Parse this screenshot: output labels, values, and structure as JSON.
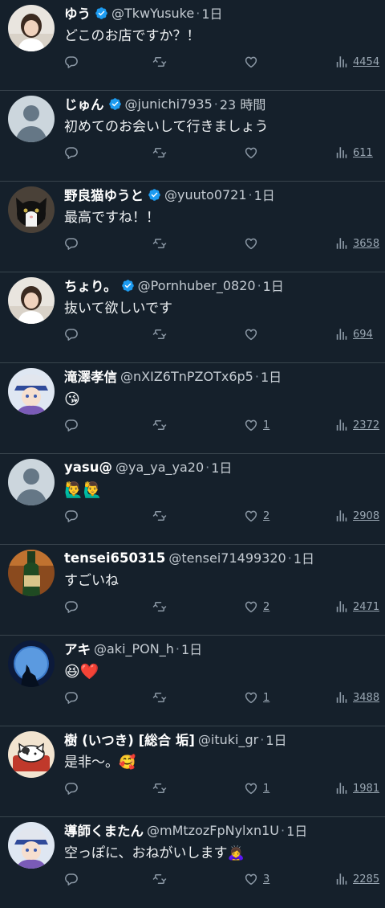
{
  "colors": {
    "background": "#15202b",
    "divider": "#38444d",
    "verified": "#1d9bf0",
    "icon": "#8b98a5"
  },
  "tweets": [
    {
      "name": "ゆう",
      "verified": true,
      "handle": "@TkwYusuke",
      "sep": "·",
      "time": "1日",
      "text": "どこのお店ですか？！",
      "likes": "",
      "views": "4454",
      "avatar": "photo-person"
    },
    {
      "name": "じゅん",
      "verified": true,
      "handle": "@junichi7935",
      "sep": "·",
      "time": "23 時間",
      "text": "初めてのお会いして行きましょう",
      "likes": "",
      "views": "611",
      "avatar": "default-avatar"
    },
    {
      "name": "野良猫ゆうと",
      "verified": true,
      "handle": "@yuuto0721",
      "sep": "·",
      "time": "1日",
      "text": "最高ですね！！",
      "likes": "",
      "views": "3658",
      "avatar": "cat-photo"
    },
    {
      "name": "ちょり。",
      "verified": true,
      "handle": "@Pornhuber_0820",
      "sep": "·",
      "time": "1日",
      "text": "抜いて欲しいです",
      "likes": "",
      "views": "694",
      "avatar": "photo-person"
    },
    {
      "name": "滝澤孝信",
      "verified": false,
      "handle": "@nXIZ6TnPZOTx6p5",
      "sep": "·",
      "time": "1日",
      "text": "😘",
      "likes": "1",
      "views": "2372",
      "avatar": "anime-illustration"
    },
    {
      "name": "yasu@",
      "verified": false,
      "handle": "@ya_ya_ya20",
      "sep": "·",
      "time": "1日",
      "text": "🙋‍♂️🙋‍♂️",
      "likes": "2",
      "views": "2908",
      "avatar": "default-avatar"
    },
    {
      "name": "tensei650315",
      "verified": false,
      "handle": "@tensei71499320",
      "sep": "·",
      "time": "1日",
      "text": "すごいね",
      "likes": "2",
      "views": "2471",
      "avatar": "bottle-photo"
    },
    {
      "name": "アキ",
      "verified": false,
      "handle": "@aki_PON_h",
      "sep": "·",
      "time": "1日",
      "text": "😆❤️",
      "likes": "1",
      "views": "3488",
      "avatar": "moon-wolf"
    },
    {
      "name": "樹 (いつき) [総合 垢]",
      "verified": false,
      "handle": "@ituki_gr",
      "sep": "·",
      "time": "1日",
      "text": "是非〜。🥰",
      "likes": "1",
      "views": "1981",
      "avatar": "cat-illustration"
    },
    {
      "name": "導師くまたん",
      "verified": false,
      "handle": "@mMtzozFpNylxn1U",
      "sep": "·",
      "time": "1日",
      "text": "空っぽに、おねがいします🙇‍♀️",
      "likes": "3",
      "views": "2285",
      "avatar": "anime-illustration"
    }
  ]
}
